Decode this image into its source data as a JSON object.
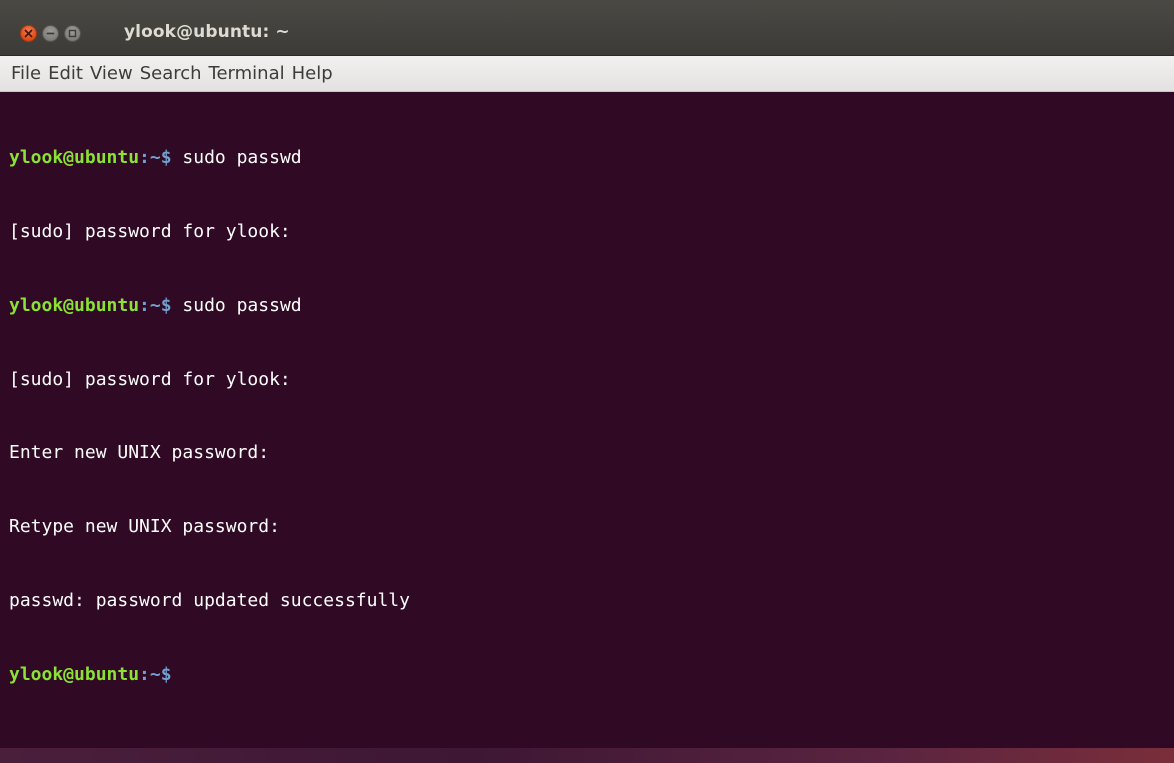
{
  "window": {
    "title": "ylook@ubuntu: ~"
  },
  "menu": {
    "items": [
      "File",
      "Edit",
      "View",
      "Search",
      "Terminal",
      "Help"
    ]
  },
  "prompt": {
    "user_host": "ylook@ubuntu",
    "path": ":~",
    "symbol": "$"
  },
  "terminal": {
    "lines": [
      {
        "type": "prompt",
        "command": " sudo passwd"
      },
      {
        "type": "output",
        "text": "[sudo] password for ylook:"
      },
      {
        "type": "prompt",
        "command": " sudo passwd"
      },
      {
        "type": "output",
        "text": "[sudo] password for ylook:"
      },
      {
        "type": "output",
        "text": "Enter new UNIX password:"
      },
      {
        "type": "output",
        "text": "Retype new UNIX password:"
      },
      {
        "type": "output",
        "text": "passwd: password updated successfully"
      },
      {
        "type": "prompt",
        "command": ""
      }
    ]
  },
  "colors": {
    "terminal_bg": "#300a24",
    "prompt_user": "#8ae234",
    "prompt_path": "#729fcf",
    "close_button": "#df4a16"
  },
  "icons": {
    "close": "close-icon",
    "minimize": "minimize-icon",
    "maximize": "maximize-icon"
  }
}
